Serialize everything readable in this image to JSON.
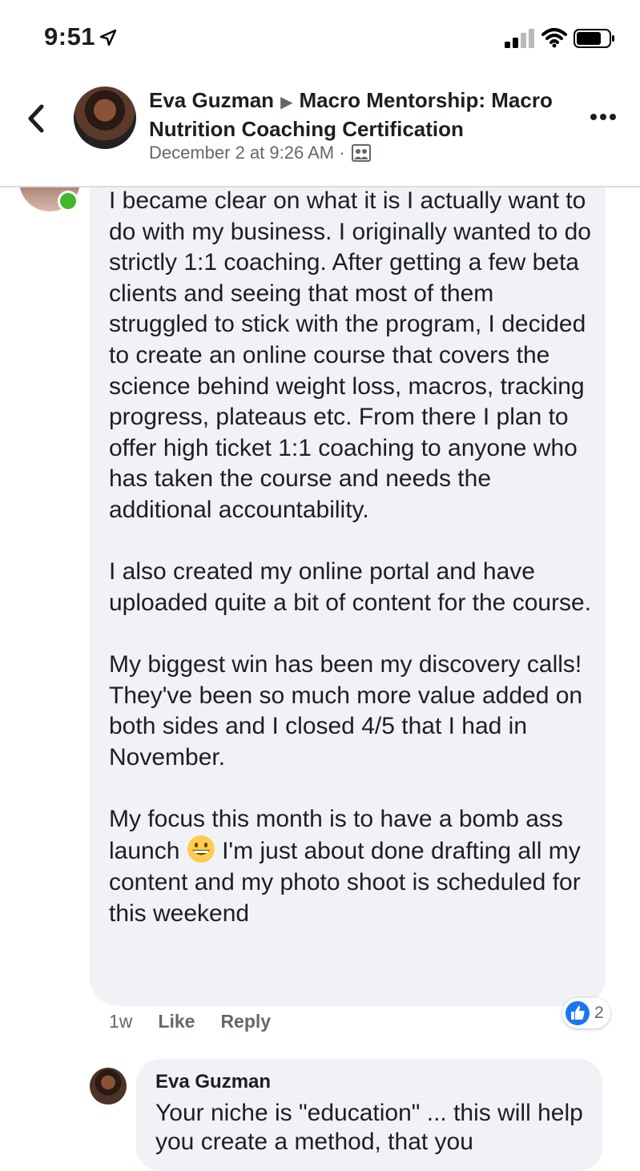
{
  "status_bar": {
    "time": "9:51"
  },
  "header": {
    "author": "Eva Guzman",
    "group": "Macro Mentorship: Macro Nutrition Coaching Certification",
    "meta": "December 2 at 9:26 AM ·"
  },
  "comment": {
    "paragraphs": [
      "I became clear on what it is I actually want to do with my business. I originally wanted to do strictly 1:1 coaching. After getting a few beta clients and seeing that most of them struggled to stick with the program, I decided to create an online course that covers the science behind weight loss, macros, tracking progress, plateaus etc. From there I plan to offer high ticket 1:1 coaching to anyone who has taken the course and needs the additional accountability.",
      "I also created my online portal and have uploaded quite a bit of content for the course.",
      "My biggest win has been my discovery calls! They've been so much more value added on both sides and I closed 4/5 that I had in November."
    ],
    "last_paragraph_before_emoji": "My focus this month is to have a bomb ass launch",
    "last_paragraph_after_emoji": " I'm just about done drafting all my content and my photo shoot is scheduled for this weekend",
    "emoji": "grinning-face-emoji",
    "age": "1w",
    "like_label": "Like",
    "reply_label": "Reply",
    "reaction_count": "2"
  },
  "reply": {
    "author": "Eva Guzman",
    "text": "Your niche is \"education\" ... this will help you create a method, that you"
  },
  "colors": {
    "accent": "#1877f2",
    "online": "#42b72a",
    "bubble": "#f0f2f5",
    "muted": "#65676b"
  }
}
